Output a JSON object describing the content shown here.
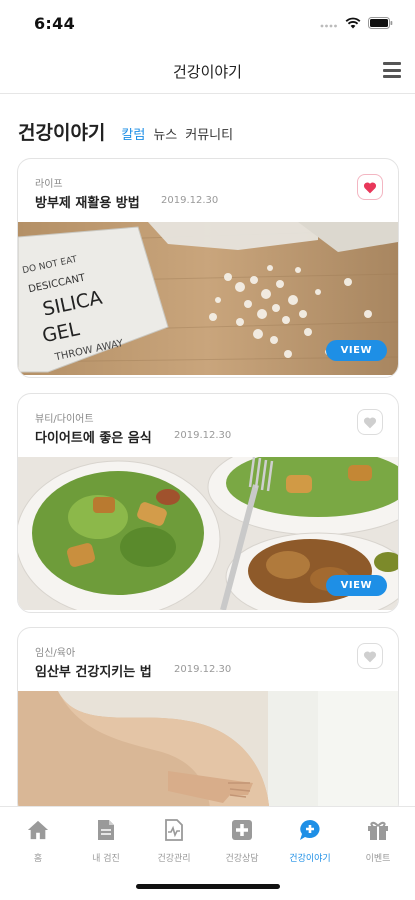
{
  "status": {
    "time": "6:44"
  },
  "nav": {
    "title": "건강이야기"
  },
  "section": {
    "title": "건강이야기",
    "tabs": [
      {
        "label": "칼럼",
        "active": true
      },
      {
        "label": "뉴스",
        "active": false
      },
      {
        "label": "커뮤니티",
        "active": false
      }
    ]
  },
  "cards": [
    {
      "category": "라이프",
      "title": "방부제 재활용 방법",
      "date": "2019.12.30",
      "liked": true,
      "image": "silica-gel-packet",
      "view_label": "VIEW"
    },
    {
      "category": "뷰티/다이어트",
      "title": "다이어트에 좋은 음식",
      "date": "2019.12.30",
      "liked": false,
      "image": "salad-bowls",
      "view_label": "VIEW"
    },
    {
      "category": "임신/육아",
      "title": "임산부 건강지키는 법",
      "date": "2019.12.30",
      "liked": false,
      "image": "pregnant-belly"
    }
  ],
  "tabbar": {
    "items": [
      {
        "label": "홈",
        "icon": "home-icon"
      },
      {
        "label": "내 검진",
        "icon": "document-icon"
      },
      {
        "label": "건강관리",
        "icon": "health-chart-icon"
      },
      {
        "label": "건강상담",
        "icon": "medical-cross-icon"
      },
      {
        "label": "건강이야기",
        "icon": "chat-icon",
        "active": true
      },
      {
        "label": "이벤트",
        "icon": "gift-icon"
      }
    ]
  },
  "colors": {
    "accent": "#1e8fe6",
    "heart": "#e8375a"
  }
}
